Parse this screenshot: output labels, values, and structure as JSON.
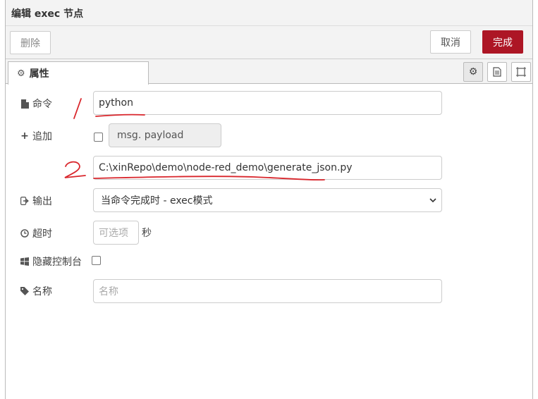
{
  "title": "编辑 exec 节点",
  "toolbar": {
    "delete_label": "删除",
    "cancel_label": "取消",
    "done_label": "完成"
  },
  "tabs": {
    "properties_label": "属性"
  },
  "form": {
    "command_label": "命令",
    "command_value": "python",
    "append_label": "追加",
    "append_placeholder": "msg. payload",
    "extra_value": "C:\\xinRepo\\demo\\node-red_demo\\generate_json.py",
    "output_label": "输出",
    "output_selected": "当命令完成时 - exec模式",
    "timeout_label": "超时",
    "timeout_placeholder": "可选项",
    "timeout_unit": "秒",
    "hide_console_label": "隐藏控制台",
    "name_label": "名称",
    "name_placeholder": "名称"
  },
  "colors": {
    "accent": "#ad1625",
    "annotation": "#d9262c"
  }
}
